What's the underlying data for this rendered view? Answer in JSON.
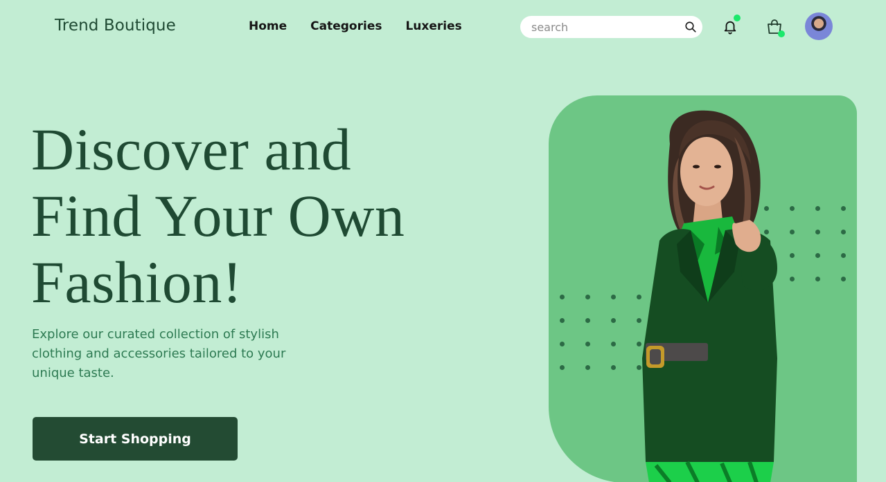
{
  "header": {
    "brand": "Trend Boutique",
    "nav": [
      {
        "label": "Home"
      },
      {
        "label": "Categories"
      },
      {
        "label": "Luxeries"
      }
    ],
    "search": {
      "placeholder": "search",
      "value": ""
    },
    "icons": {
      "search": "search-icon",
      "notifications": "bell-icon",
      "cart": "shopping-bag-icon",
      "profile": "avatar"
    },
    "badge_color": "#1be86b"
  },
  "hero": {
    "title_lines": [
      "Discover and",
      "Find Your Own",
      "Fashion!"
    ],
    "subtitle": "Explore our curated collection of stylish clothing and accessories tailored to your unique taste.",
    "cta_label": "Start Shopping"
  },
  "colors": {
    "background": "#c2edd3",
    "primary": "#234b33",
    "panel": "#6dc685",
    "text_accent": "#2d7a52"
  }
}
